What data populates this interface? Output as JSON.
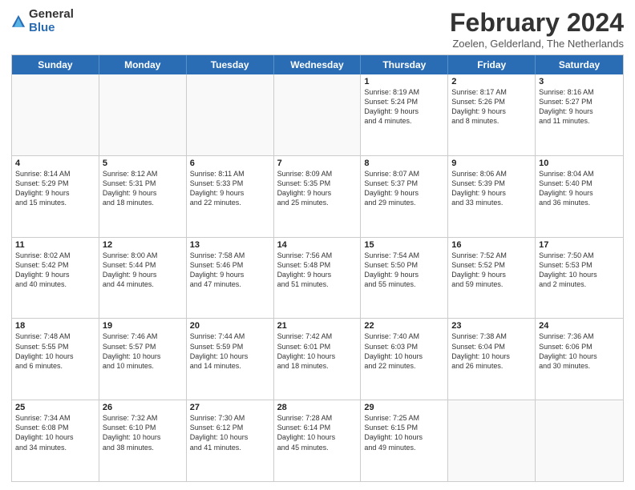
{
  "logo": {
    "general": "General",
    "blue": "Blue"
  },
  "title": "February 2024",
  "subtitle": "Zoelen, Gelderland, The Netherlands",
  "headers": [
    "Sunday",
    "Monday",
    "Tuesday",
    "Wednesday",
    "Thursday",
    "Friday",
    "Saturday"
  ],
  "weeks": [
    [
      {
        "day": "",
        "info": ""
      },
      {
        "day": "",
        "info": ""
      },
      {
        "day": "",
        "info": ""
      },
      {
        "day": "",
        "info": ""
      },
      {
        "day": "1",
        "info": "Sunrise: 8:19 AM\nSunset: 5:24 PM\nDaylight: 9 hours\nand 4 minutes."
      },
      {
        "day": "2",
        "info": "Sunrise: 8:17 AM\nSunset: 5:26 PM\nDaylight: 9 hours\nand 8 minutes."
      },
      {
        "day": "3",
        "info": "Sunrise: 8:16 AM\nSunset: 5:27 PM\nDaylight: 9 hours\nand 11 minutes."
      }
    ],
    [
      {
        "day": "4",
        "info": "Sunrise: 8:14 AM\nSunset: 5:29 PM\nDaylight: 9 hours\nand 15 minutes."
      },
      {
        "day": "5",
        "info": "Sunrise: 8:12 AM\nSunset: 5:31 PM\nDaylight: 9 hours\nand 18 minutes."
      },
      {
        "day": "6",
        "info": "Sunrise: 8:11 AM\nSunset: 5:33 PM\nDaylight: 9 hours\nand 22 minutes."
      },
      {
        "day": "7",
        "info": "Sunrise: 8:09 AM\nSunset: 5:35 PM\nDaylight: 9 hours\nand 25 minutes."
      },
      {
        "day": "8",
        "info": "Sunrise: 8:07 AM\nSunset: 5:37 PM\nDaylight: 9 hours\nand 29 minutes."
      },
      {
        "day": "9",
        "info": "Sunrise: 8:06 AM\nSunset: 5:39 PM\nDaylight: 9 hours\nand 33 minutes."
      },
      {
        "day": "10",
        "info": "Sunrise: 8:04 AM\nSunset: 5:40 PM\nDaylight: 9 hours\nand 36 minutes."
      }
    ],
    [
      {
        "day": "11",
        "info": "Sunrise: 8:02 AM\nSunset: 5:42 PM\nDaylight: 9 hours\nand 40 minutes."
      },
      {
        "day": "12",
        "info": "Sunrise: 8:00 AM\nSunset: 5:44 PM\nDaylight: 9 hours\nand 44 minutes."
      },
      {
        "day": "13",
        "info": "Sunrise: 7:58 AM\nSunset: 5:46 PM\nDaylight: 9 hours\nand 47 minutes."
      },
      {
        "day": "14",
        "info": "Sunrise: 7:56 AM\nSunset: 5:48 PM\nDaylight: 9 hours\nand 51 minutes."
      },
      {
        "day": "15",
        "info": "Sunrise: 7:54 AM\nSunset: 5:50 PM\nDaylight: 9 hours\nand 55 minutes."
      },
      {
        "day": "16",
        "info": "Sunrise: 7:52 AM\nSunset: 5:52 PM\nDaylight: 9 hours\nand 59 minutes."
      },
      {
        "day": "17",
        "info": "Sunrise: 7:50 AM\nSunset: 5:53 PM\nDaylight: 10 hours\nand 2 minutes."
      }
    ],
    [
      {
        "day": "18",
        "info": "Sunrise: 7:48 AM\nSunset: 5:55 PM\nDaylight: 10 hours\nand 6 minutes."
      },
      {
        "day": "19",
        "info": "Sunrise: 7:46 AM\nSunset: 5:57 PM\nDaylight: 10 hours\nand 10 minutes."
      },
      {
        "day": "20",
        "info": "Sunrise: 7:44 AM\nSunset: 5:59 PM\nDaylight: 10 hours\nand 14 minutes."
      },
      {
        "day": "21",
        "info": "Sunrise: 7:42 AM\nSunset: 6:01 PM\nDaylight: 10 hours\nand 18 minutes."
      },
      {
        "day": "22",
        "info": "Sunrise: 7:40 AM\nSunset: 6:03 PM\nDaylight: 10 hours\nand 22 minutes."
      },
      {
        "day": "23",
        "info": "Sunrise: 7:38 AM\nSunset: 6:04 PM\nDaylight: 10 hours\nand 26 minutes."
      },
      {
        "day": "24",
        "info": "Sunrise: 7:36 AM\nSunset: 6:06 PM\nDaylight: 10 hours\nand 30 minutes."
      }
    ],
    [
      {
        "day": "25",
        "info": "Sunrise: 7:34 AM\nSunset: 6:08 PM\nDaylight: 10 hours\nand 34 minutes."
      },
      {
        "day": "26",
        "info": "Sunrise: 7:32 AM\nSunset: 6:10 PM\nDaylight: 10 hours\nand 38 minutes."
      },
      {
        "day": "27",
        "info": "Sunrise: 7:30 AM\nSunset: 6:12 PM\nDaylight: 10 hours\nand 41 minutes."
      },
      {
        "day": "28",
        "info": "Sunrise: 7:28 AM\nSunset: 6:14 PM\nDaylight: 10 hours\nand 45 minutes."
      },
      {
        "day": "29",
        "info": "Sunrise: 7:25 AM\nSunset: 6:15 PM\nDaylight: 10 hours\nand 49 minutes."
      },
      {
        "day": "",
        "info": ""
      },
      {
        "day": "",
        "info": ""
      }
    ]
  ]
}
